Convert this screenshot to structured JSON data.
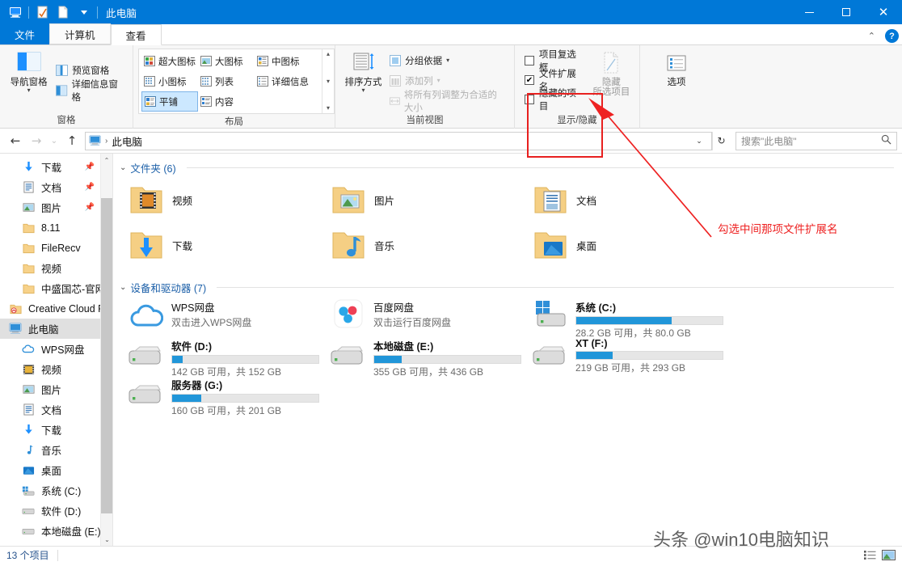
{
  "titlebar": {
    "title": "此电脑",
    "qat_icons": [
      "computer-icon",
      "properties-icon",
      "new-folder-icon",
      "dropdown-caret-icon"
    ],
    "minimize_label": "",
    "maximize_label": "",
    "close_label": "✕",
    "accent_color": "#0078d7"
  },
  "tabs": {
    "file": "文件",
    "items": [
      {
        "label": "计算机",
        "active": false
      },
      {
        "label": "查看",
        "active": true
      }
    ],
    "collapse_icon": "chevron-up-icon",
    "help_label": "?"
  },
  "ribbon": {
    "groups": [
      {
        "name": "窗格",
        "big_button": {
          "label": "导航窗格",
          "icon": "nav-pane-icon",
          "caret": "▾"
        },
        "small_buttons": [
          {
            "label": "预览窗格",
            "icon": "preview-pane-icon",
            "disabled": false
          },
          {
            "label": "详细信息窗格",
            "icon": "details-pane-icon",
            "disabled": false
          }
        ]
      },
      {
        "name": "布局",
        "gallery": [
          {
            "label": "超大图标",
            "icon": "extra-large-icons-icon",
            "selected": false
          },
          {
            "label": "大图标",
            "icon": "large-icons-icon",
            "selected": false
          },
          {
            "label": "中图标",
            "icon": "medium-icons-icon",
            "selected": false
          },
          {
            "label": "小图标",
            "icon": "small-icons-icon",
            "selected": false
          },
          {
            "label": "列表",
            "icon": "list-view-icon",
            "selected": false
          },
          {
            "label": "详细信息",
            "icon": "details-view-icon",
            "selected": false
          },
          {
            "label": "平铺",
            "icon": "tiles-view-icon",
            "selected": true
          },
          {
            "label": "内容",
            "icon": "content-view-icon",
            "selected": false
          }
        ],
        "scroll_up": "▴",
        "scroll_down": "▾",
        "scroll_more": "▾"
      },
      {
        "name": "当前视图",
        "big_button": {
          "label": "排序方式",
          "icon": "sort-by-icon",
          "caret": "▾"
        },
        "small_buttons": [
          {
            "label": "分组依据",
            "icon": "group-by-icon",
            "caret": "▾",
            "disabled": false
          },
          {
            "label": "添加列",
            "icon": "add-columns-icon",
            "caret": "▾",
            "disabled": true
          },
          {
            "label": "将所有列调整为合适的大小",
            "icon": "fit-columns-icon",
            "disabled": true
          }
        ]
      },
      {
        "name": "显示/隐藏",
        "checkboxes": [
          {
            "label": "项目复选框",
            "checked": false
          },
          {
            "label": "文件扩展名",
            "checked": true
          },
          {
            "label": "隐藏的项目",
            "checked": false
          }
        ],
        "big_button": {
          "label_line1": "隐藏",
          "label_line2": "所选项目",
          "icon": "hide-items-icon",
          "disabled": true
        }
      },
      {
        "name": "",
        "big_button": {
          "label": "选项",
          "icon": "options-icon"
        }
      }
    ],
    "highlight_color": "#e8201f"
  },
  "addressbar": {
    "back_icon": "arrow-left-icon",
    "forward_icon": "arrow-right-icon",
    "recent_icon": "chevron-down-icon",
    "up_icon": "arrow-up-icon",
    "path_icon": "computer-icon",
    "path_separator": "›",
    "path_label": "此电脑",
    "dropdown_icon": "chevron-down-icon",
    "refresh_icon": "refresh-icon",
    "search_placeholder": "搜索\"此电脑\"",
    "search_value": "",
    "search_icon": "search-icon"
  },
  "navpane": {
    "items": [
      {
        "label": "下载",
        "icon": "download-icon",
        "pinned": true,
        "indent": 1,
        "selected": false
      },
      {
        "label": "文档",
        "icon": "documents-icon",
        "pinned": true,
        "indent": 1,
        "selected": false
      },
      {
        "label": "图片",
        "icon": "pictures-icon",
        "pinned": true,
        "indent": 1,
        "selected": false
      },
      {
        "label": "8.11",
        "icon": "folder-icon",
        "pinned": false,
        "indent": 1,
        "selected": false
      },
      {
        "label": "FileRecv",
        "icon": "folder-icon",
        "pinned": false,
        "indent": 1,
        "selected": false
      },
      {
        "label": "视频",
        "icon": "folder-icon",
        "pinned": false,
        "indent": 1,
        "selected": false
      },
      {
        "label": "中盛国芯-官网",
        "icon": "folder-icon",
        "pinned": false,
        "indent": 1,
        "selected": false
      },
      {
        "label": "Creative Cloud F",
        "icon": "creative-cloud-icon",
        "pinned": false,
        "indent": 0,
        "selected": false
      },
      {
        "label": "此电脑",
        "icon": "computer-icon",
        "pinned": false,
        "indent": 0,
        "selected": true
      },
      {
        "label": "WPS网盘",
        "icon": "wps-cloud-icon",
        "pinned": false,
        "indent": 1,
        "selected": false
      },
      {
        "label": "视频",
        "icon": "videos-icon",
        "pinned": false,
        "indent": 1,
        "selected": false
      },
      {
        "label": "图片",
        "icon": "pictures-icon",
        "pinned": false,
        "indent": 1,
        "selected": false
      },
      {
        "label": "文档",
        "icon": "documents-icon",
        "pinned": false,
        "indent": 1,
        "selected": false
      },
      {
        "label": "下载",
        "icon": "download-icon",
        "pinned": false,
        "indent": 1,
        "selected": false
      },
      {
        "label": "音乐",
        "icon": "music-icon",
        "pinned": false,
        "indent": 1,
        "selected": false
      },
      {
        "label": "桌面",
        "icon": "desktop-icon",
        "pinned": false,
        "indent": 1,
        "selected": false
      },
      {
        "label": "系统 (C:)",
        "icon": "windows-drive-icon",
        "pinned": false,
        "indent": 1,
        "selected": false
      },
      {
        "label": "软件 (D:)",
        "icon": "drive-icon",
        "pinned": false,
        "indent": 1,
        "selected": false
      },
      {
        "label": "本地磁盘 (E:)",
        "icon": "drive-icon",
        "pinned": false,
        "indent": 1,
        "selected": false
      }
    ],
    "scroll_up_icon": "chevron-up-icon",
    "scroll_down_icon": "chevron-down-icon"
  },
  "main": {
    "folders_group": {
      "title": "文件夹 (6)",
      "caret": "⌄"
    },
    "folders": [
      {
        "name": "视频",
        "icon": "folder-videos-icon"
      },
      {
        "name": "图片",
        "icon": "folder-pictures-icon"
      },
      {
        "name": "文档",
        "icon": "folder-documents-icon"
      },
      {
        "name": "下载",
        "icon": "folder-downloads-icon"
      },
      {
        "name": "音乐",
        "icon": "folder-music-icon"
      },
      {
        "name": "桌面",
        "icon": "folder-desktop-icon"
      }
    ],
    "devices_group": {
      "title": "设备和驱动器 (7)",
      "caret": "⌄"
    },
    "devices": [
      {
        "name": "WPS网盘",
        "icon": "wps-cloud-icon",
        "subtitle": "双击进入WPS网盘",
        "has_bar": false
      },
      {
        "name": "百度网盘",
        "icon": "baidu-cloud-icon",
        "subtitle": "双击运行百度网盘",
        "has_bar": false
      },
      {
        "name": "系统 (C:)",
        "icon": "windows-drive-icon",
        "has_bar": true,
        "free": "28.2 GB",
        "total": "80.0 GB",
        "usage_text": "28.2 GB 可用，共 80.0 GB",
        "fill_pct": 65
      },
      {
        "name": "软件 (D:)",
        "icon": "drive-icon",
        "has_bar": true,
        "free": "142 GB",
        "total": "152 GB",
        "usage_text": "142 GB 可用，共 152 GB",
        "fill_pct": 7
      },
      {
        "name": "本地磁盘 (E:)",
        "icon": "drive-icon",
        "has_bar": true,
        "free": "355 GB",
        "total": "436 GB",
        "usage_text": "355 GB 可用，共 436 GB",
        "fill_pct": 19
      },
      {
        "name": "XT (F:)",
        "icon": "drive-icon",
        "has_bar": true,
        "free": "219 GB",
        "total": "293 GB",
        "usage_text": "219 GB 可用，共 293 GB",
        "fill_pct": 25
      },
      {
        "name": "服务器 (G:)",
        "icon": "drive-icon",
        "has_bar": true,
        "free": "160 GB",
        "total": "201 GB",
        "usage_text": "160 GB 可用，共 201 GB",
        "fill_pct": 20
      }
    ]
  },
  "statusbar": {
    "item_count": "13 个项目",
    "detail_view_icon": "details-view-icon",
    "tile_view_icon": "large-icons-view-icon"
  },
  "annotations": {
    "callout_text": "勾选中间那项文件扩展名",
    "arrow_color": "#ee2222",
    "box_color": "#e8201f"
  },
  "watermark": {
    "text": "头条 @win10电脑知识"
  }
}
